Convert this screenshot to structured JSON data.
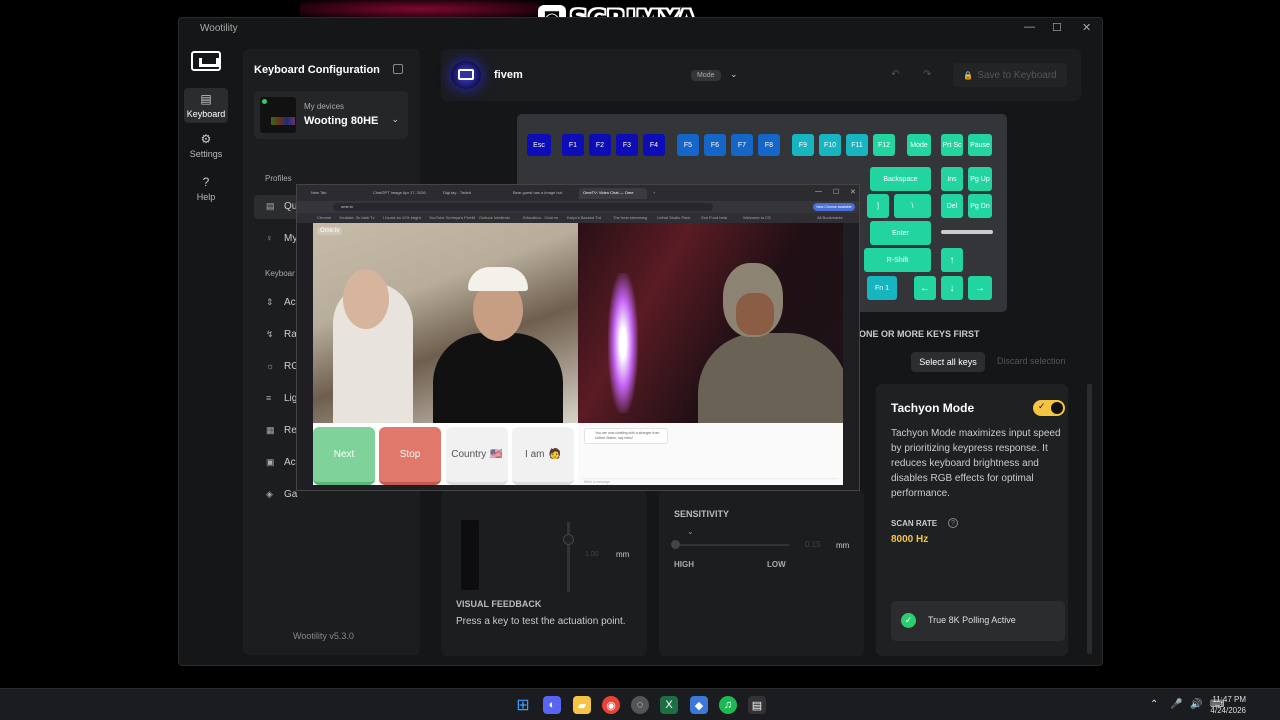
{
  "overlay_logo": {
    "glyph": "◙",
    "name": "SCRIMYA"
  },
  "window": {
    "title": "Wootility",
    "controls": [
      "—",
      "☐",
      "✕"
    ]
  },
  "rail": {
    "items": [
      {
        "label": "Keyboard",
        "icon": "keyboard-icon",
        "glyph": "▤"
      },
      {
        "label": "Settings",
        "icon": "gear-icon",
        "glyph": "⚙"
      },
      {
        "label": "Help",
        "icon": "help-icon",
        "glyph": "?"
      }
    ]
  },
  "sidebar": {
    "title": "Keyboard Configuration",
    "device_label": "My devices",
    "device_name": "Wooting 80HE",
    "profiles_heading": "Profiles",
    "profiles": [
      {
        "label": "Qu",
        "glyph": "▤"
      },
      {
        "label": "My",
        "glyph": "♀"
      }
    ],
    "keyboard_heading": "Keyboar",
    "keyboard_items": [
      {
        "label": "Ac",
        "glyph": "⇕"
      },
      {
        "label": "Ra",
        "glyph": "↯"
      },
      {
        "label": "RG",
        "glyph": "☼"
      },
      {
        "label": "Lig",
        "glyph": "≡"
      },
      {
        "label": "Re",
        "glyph": "▦"
      },
      {
        "label": "Ac",
        "glyph": "▣"
      },
      {
        "label": "Ga",
        "glyph": "◈"
      }
    ],
    "version": "Wootility v5.3.0"
  },
  "header": {
    "profile_name": "fivem",
    "mode_label": "Mode",
    "mode_chevron": "⌄",
    "undo_glyph": "↶",
    "redo_glyph": "↷",
    "save_label": "Save to Keyboard",
    "save_glyph": "🔒"
  },
  "keys": {
    "row1": [
      "Esc",
      "F1",
      "F2",
      "F3",
      "F4",
      "F5",
      "F6",
      "F7",
      "F8",
      "F9",
      "F10",
      "F11",
      "F12",
      "Mode",
      "Prt Sc",
      "Pause"
    ],
    "row2": [
      "Backspace",
      "Ins",
      "Pg Up"
    ],
    "row3": [
      "]",
      "\\",
      "Del",
      "Pg Dn"
    ],
    "row4": [
      "Enter"
    ],
    "row5": [
      "R-Shift",
      "↑"
    ],
    "row6": [
      "Fn 1",
      "←",
      "↓",
      "→"
    ]
  },
  "selection": {
    "prompt": "ONE OR MORE KEYS FIRST",
    "select_all": "Select all keys",
    "discard": "Discard selection"
  },
  "tachyon": {
    "title": "Tachyon Mode",
    "toggle_on": true,
    "toggle_glyph": "✓",
    "description": "Tachyon Mode maximizes input speed by prioritizing keypress response. It reduces keyboard brightness and disables RGB effects for optimal performance.",
    "scan_rate_label": "SCAN RATE",
    "scan_rate_value": "8000 Hz",
    "polling_label": "True 8K Polling Active",
    "polling_glyph": "✓",
    "info_glyph": "?"
  },
  "actuation": {
    "value": "1.00",
    "unit": "mm"
  },
  "sensitivity": {
    "label": "SENSITIVITY",
    "chevron": "⌄",
    "value": "0.15",
    "unit": "mm",
    "high": "HIGH",
    "low": "LOW"
  },
  "visual_feedback": {
    "label": "VISUAL FEEDBACK",
    "description": "Press a key to test the actuation point."
  },
  "browser": {
    "tabs": [
      "New Tab",
      "ChatGPT Image Apr 17, 2026",
      "Digi.tay - Twitch",
      "Bear guest has a image but",
      "OmeTV: Video Chat — Ome",
      "+"
    ],
    "window_controls": [
      "—",
      "☐",
      "✕"
    ],
    "url": "ome.tv",
    "new_chrome_badge": "New Chrome available",
    "bookmarks": [
      "Chrome",
      "Youtube: Sc blah Tv",
      "I found an 11% bright",
      "YouTube Scrimya's FiveM",
      "Outlook Intellecto",
      "Education - Chat vs",
      "Kaiyo's Backed Tut",
      "The best streaming",
      "Lethal Studio Pack",
      "Zed Fund beta",
      "Welcome to CS",
      "All Bookmarks"
    ],
    "site_logo": "Ome.tv",
    "buttons": {
      "next": "Next",
      "stop": "Stop",
      "country": "Country",
      "country_flag": "🇺🇸",
      "iam": "I am",
      "iam_emoji": "🧑"
    },
    "chat_message": "You are now chatting with a stranger from United States, say hello!",
    "chat_placeholder": "Write a message"
  },
  "taskbar": {
    "icons": [
      {
        "name": "windows-start",
        "glyph": "⊞",
        "color": "#3aa0ff"
      },
      {
        "name": "discord",
        "glyph": "◐",
        "color": "#5865f2"
      },
      {
        "name": "file-explorer",
        "glyph": "▰",
        "color": "#f6c343"
      },
      {
        "name": "chrome",
        "glyph": "◉",
        "color": "#e94335"
      },
      {
        "name": "obs",
        "glyph": "◌",
        "color": "#555555"
      },
      {
        "name": "excel",
        "glyph": "X",
        "color": "#1d6f42"
      },
      {
        "name": "app-blue",
        "glyph": "◆",
        "color": "#3b78d8"
      },
      {
        "name": "spotify",
        "glyph": "♫",
        "color": "#1db954"
      },
      {
        "name": "wootility",
        "glyph": "▤",
        "color": "#333333"
      }
    ],
    "tray": [
      "⌃",
      "🎤",
      "🔊",
      "⌨"
    ],
    "time": "11:47 PM",
    "date": "4/24/2026"
  }
}
